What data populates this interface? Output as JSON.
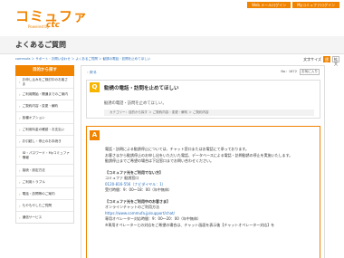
{
  "header": {
    "logo": "コミュファ",
    "logo_sub": "Powered by",
    "logo_brand": "ctc",
    "buttons": [
      "Web メールログイン",
      "Myコミュファログイン"
    ]
  },
  "page_title": "よくあるご質問",
  "breadcrumb": "commufa ＞ サポート・お問い合わせ ＞ よくあるご質問 ＞ 勧誘の電話・訪問を止めてほしい",
  "font_size": {
    "label": "文字サイズ",
    "options": [
      "標準",
      "拡大"
    ]
  },
  "sidebar": {
    "heading": "目的から探す",
    "items": [
      "お申し込みをご検討中のお客さま",
      "ご利用開始・開通までのご案内",
      "ご契約内容・変更・解約",
      "各種オプション",
      "ご利用料金の確認・お支払い",
      "お引越し・停止のお手続き",
      "ID・パスワード・Myコミュファ情報",
      "接続・設定方法",
      "ご利用トラブル",
      "電話・訪問等のご案内",
      "もやもやしたご質問",
      "通信サービス"
    ]
  },
  "main": {
    "back": "戻る",
    "faq_no": "No：1872",
    "bookmark": "お気に入り",
    "q_label": "Q",
    "q_title": "勧誘の電話・訪問を止めてほしい",
    "q_sub": "勧誘の電話・訪問を止めてほしい。",
    "q_cats": "カテゴリー：目的から探す ＞ ご契約内容・変更・解約 ＞ ご契約内容",
    "a_label": "A",
    "a_lines": [
      "電話・訪問による勧誘停止については、チャット窓口またはお電話にて承っております。",
      "お客さまから勧誘停止のお申し出をいただいた電話、データベースによる電話・訪問勧誘の停止を実施いたします。",
      "勧誘停止までご希望の場合は下記窓口までお問い合わせください。"
    ],
    "section1_title": "【コミュファ光をご利用でない方】",
    "section1_name": "コミュファ 勧誘窓口",
    "section1_phone": "0120-816-556（ナビダイヤル：1）",
    "section1_hours": "受付時間：9：00～18：00（年中無休）",
    "section2_title": "【コミュファ光をご利用中のお客さま】",
    "section2_name": "オンラインチャットのご利用方法",
    "section2_link": "https://www.commufa.jp/support/chat/",
    "section2_hours": "専用オペレーター対応時間：9：00～20：00（年中無休）",
    "section2_note": "※専用オペレーターとの対応をご希望の場合は、チャット画面を表示後【チャットオペレーター対応】を"
  }
}
